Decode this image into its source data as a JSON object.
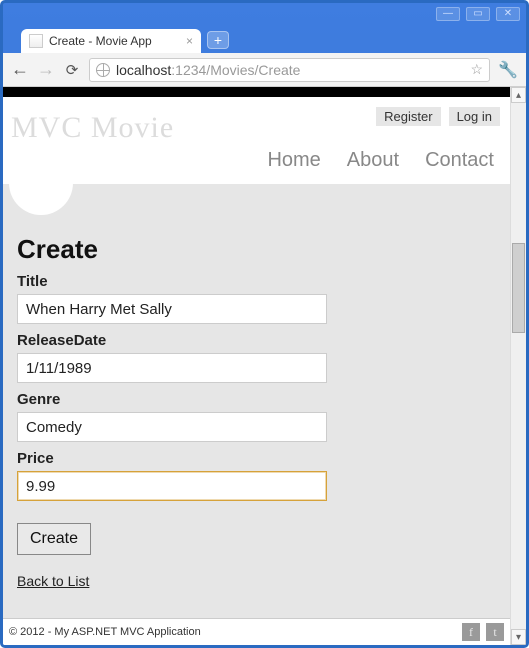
{
  "browser": {
    "tab_title": "Create - Movie App",
    "url_host": "localhost",
    "url_port_path": ":1234/Movies/Create"
  },
  "header": {
    "brand": "MVC Movie",
    "account": {
      "register": "Register",
      "login": "Log in"
    },
    "nav": {
      "home": "Home",
      "about": "About",
      "contact": "Contact"
    }
  },
  "page": {
    "title": "Create",
    "fields": {
      "title": {
        "label": "Title",
        "value": "When Harry Met Sally"
      },
      "release_date": {
        "label": "ReleaseDate",
        "value": "1/11/1989"
      },
      "genre": {
        "label": "Genre",
        "value": "Comedy"
      },
      "price": {
        "label": "Price",
        "value": "9.99"
      }
    },
    "submit_label": "Create",
    "back_link": "Back to List"
  },
  "footer": {
    "copyright": "© 2012 - My ASP.NET MVC Application"
  }
}
